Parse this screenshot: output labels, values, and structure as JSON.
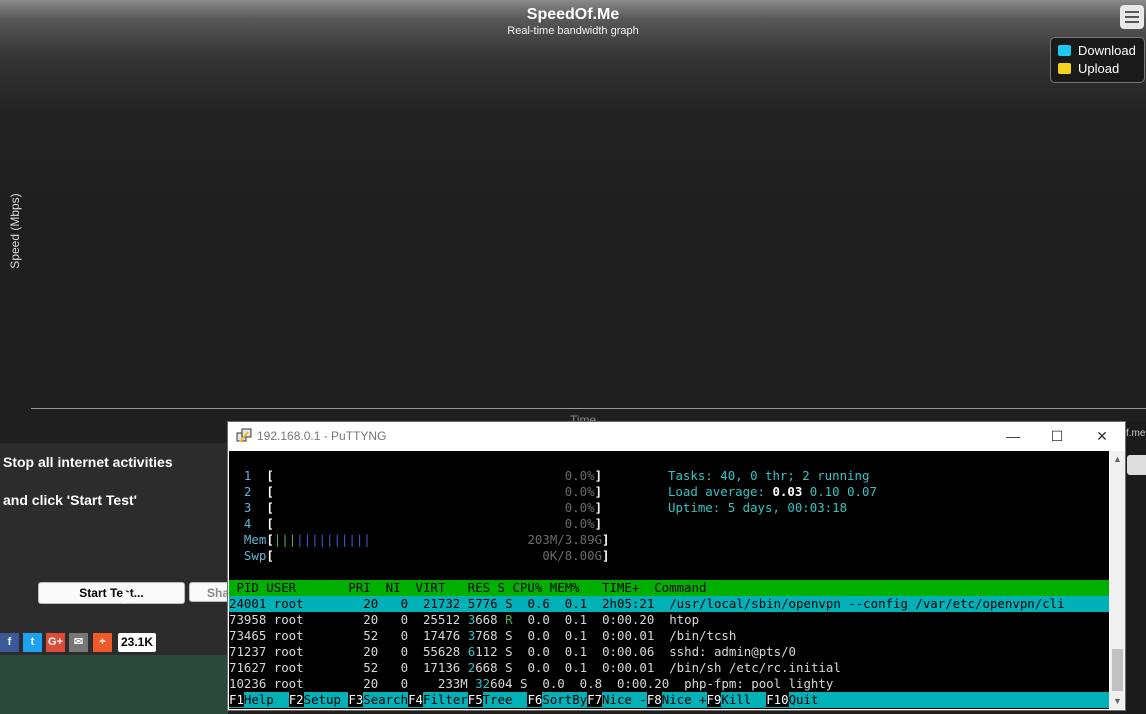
{
  "speedtest": {
    "title": "SpeedOf.Me",
    "subtitle": "Real-time bandwidth graph",
    "ylabel": "Speed (Mbps)",
    "xlabel": "Time",
    "legend": [
      {
        "label": "Download",
        "color": "#1ec8f0"
      },
      {
        "label": "Upload",
        "color": "#f5d21e"
      }
    ],
    "instruction_1": "Stop all internet activities",
    "instruction_2": "and click 'Start Test'",
    "start_button": "Start Test...",
    "share_button": "Sha",
    "share_count": "23.1K",
    "social": [
      {
        "name": "facebook",
        "glyph": "f",
        "color": "#3b5998"
      },
      {
        "name": "twitter",
        "glyph": "t",
        "color": "#1da1f2"
      },
      {
        "name": "google-plus",
        "glyph": "G+",
        "color": "#dd4b39"
      },
      {
        "name": "email",
        "glyph": "✉",
        "color": "#777777"
      },
      {
        "name": "more",
        "glyph": "+",
        "color": "#f05a28"
      }
    ],
    "fragment_text": "f.me"
  },
  "putty": {
    "title": "192.168.0.1 - PuTTYNG",
    "controls": {
      "minimize": "—",
      "maximize": "☐",
      "close": "✕"
    },
    "cpu_rows": [
      {
        "num": "1",
        "pct": "0.0%"
      },
      {
        "num": "2",
        "pct": "0.0%"
      },
      {
        "num": "3",
        "pct": "0.0%"
      },
      {
        "num": "4",
        "pct": "0.0%"
      }
    ],
    "mem": {
      "label": "Mem",
      "bars": "|||||||||||||",
      "value": "203M/3.89G"
    },
    "swp": {
      "label": "Swp",
      "value": "0K/8.00G"
    },
    "tasks": {
      "label": "Tasks:",
      "value": "40, 0 thr; 2 running"
    },
    "load": {
      "label": "Load average:",
      "v1": "0.03",
      "v2": "0.10",
      "v3": "0.07"
    },
    "uptime": {
      "label": "Uptime:",
      "value": "5 days, 00:03:18"
    },
    "columns": " PID USER       PRI  NI  VIRT   RES S CPU% MEM%   TIME+  Command",
    "processes": [
      {
        "pid": "24001",
        "user": "root",
        "pri": "20",
        "ni": "0",
        "virt": "21732",
        "res": "5776",
        "s": "S",
        "cpu": "0.6",
        "mem": "0.1",
        "time": "2h05:21",
        "cmd": "/usr/local/sbin/openvpn --config /var/etc/openvpn/cli"
      },
      {
        "pid": "73958",
        "user": "root",
        "pri": "20",
        "ni": "0",
        "virt": "25512",
        "res": "3668",
        "s": "R",
        "cpu": "0.0",
        "mem": "0.1",
        "time": "0:00.20",
        "cmd": "htop"
      },
      {
        "pid": "73465",
        "user": "root",
        "pri": "52",
        "ni": "0",
        "virt": "17476",
        "res": "3768",
        "s": "S",
        "cpu": "0.0",
        "mem": "0.1",
        "time": "0:00.01",
        "cmd": "/bin/tcsh"
      },
      {
        "pid": "71237",
        "user": "root",
        "pri": "20",
        "ni": "0",
        "virt": "55628",
        "res": "6112",
        "s": "S",
        "cpu": "0.0",
        "mem": "0.1",
        "time": "0:00.06",
        "cmd": "sshd: admin@pts/0"
      },
      {
        "pid": "71627",
        "user": "root",
        "pri": "52",
        "ni": "0",
        "virt": "17136",
        "res": "2668",
        "s": "S",
        "cpu": "0.0",
        "mem": "0.1",
        "time": "0:00.01",
        "cmd": "/bin/sh /etc/rc.initial"
      },
      {
        "pid": "10236",
        "user": "root",
        "pri": "20",
        "ni": "0",
        "virt": "233M",
        "res": "32604",
        "s": "S",
        "cpu": "0.0",
        "mem": "0.8",
        "time": "0:00.20",
        "cmd": "php-fpm: pool lighty"
      }
    ],
    "fkeys": [
      {
        "key": "F1",
        "label": "Help  "
      },
      {
        "key": "F2",
        "label": "Setup "
      },
      {
        "key": "F3",
        "label": "Search"
      },
      {
        "key": "F4",
        "label": "Filter"
      },
      {
        "key": "F5",
        "label": "Tree  "
      },
      {
        "key": "F6",
        "label": "SortBy"
      },
      {
        "key": "F7",
        "label": "Nice -"
      },
      {
        "key": "F8",
        "label": "Nice +"
      },
      {
        "key": "F9",
        "label": "Kill  "
      },
      {
        "key": "F10",
        "label": "Quit"
      }
    ]
  }
}
